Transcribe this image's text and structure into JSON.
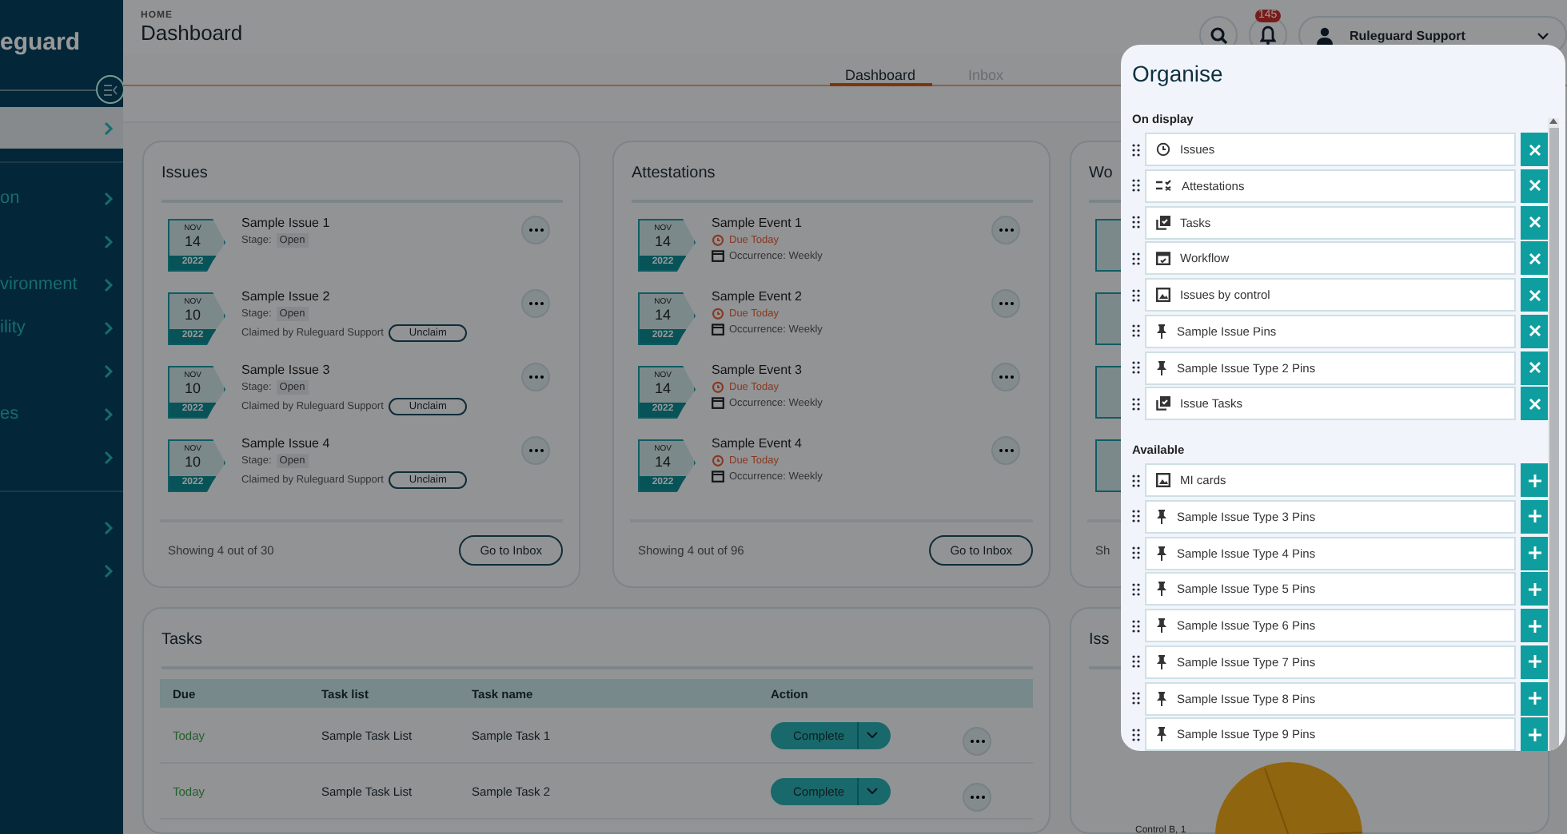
{
  "sidebar": {
    "logo": "eguard",
    "items": [
      {
        "selected": true
      },
      {
        "label": "on",
        "selected": false
      },
      {
        "selected": false
      },
      {
        "label": "vironment",
        "selected": false
      },
      {
        "label": "ility",
        "selected": false
      },
      {
        "selected": false
      },
      {
        "label": "es",
        "selected": false
      },
      {
        "selected": false
      },
      {
        "selected": false
      },
      {
        "selected": false
      }
    ]
  },
  "header": {
    "breadcrumb": "HOME",
    "title": "Dashboard",
    "notifications": "145",
    "user": "Ruleguard Support"
  },
  "tabs": [
    {
      "label": "Dashboard",
      "selected": true
    },
    {
      "label": "Inbox",
      "selected": false
    }
  ],
  "issues": {
    "title": "Issues",
    "footer": "Showing 4 out of 30",
    "button": "Go to Inbox",
    "items": [
      {
        "month": "NOV",
        "day": "14",
        "year": "2022",
        "title": "Sample Issue 1",
        "stage_label": "Stage:",
        "stage": "Open"
      },
      {
        "month": "NOV",
        "day": "10",
        "year": "2022",
        "title": "Sample Issue 2",
        "stage_label": "Stage:",
        "stage": "Open",
        "claimed": "Claimed by Ruleguard Support",
        "action": "Unclaim"
      },
      {
        "month": "NOV",
        "day": "10",
        "year": "2022",
        "title": "Sample Issue 3",
        "stage_label": "Stage:",
        "stage": "Open",
        "claimed": "Claimed by Ruleguard Support",
        "action": "Unclaim"
      },
      {
        "month": "NOV",
        "day": "10",
        "year": "2022",
        "title": "Sample Issue 4",
        "stage_label": "Stage:",
        "stage": "Open",
        "claimed": "Claimed by Ruleguard Support",
        "action": "Unclaim"
      }
    ]
  },
  "attestations": {
    "title": "Attestations",
    "footer": "Showing 4 out of 96",
    "button": "Go to Inbox",
    "items": [
      {
        "month": "NOV",
        "day": "14",
        "year": "2022",
        "title": "Sample Event 1",
        "due": "Due Today",
        "occurrence": "Occurrence: Weekly"
      },
      {
        "month": "NOV",
        "day": "14",
        "year": "2022",
        "title": "Sample Event 2",
        "due": "Due Today",
        "occurrence": "Occurrence: Weekly"
      },
      {
        "month": "NOV",
        "day": "14",
        "year": "2022",
        "title": "Sample Event 3",
        "due": "Due Today",
        "occurrence": "Occurrence: Weekly"
      },
      {
        "month": "NOV",
        "day": "14",
        "year": "2022",
        "title": "Sample Event 4",
        "due": "Due Today",
        "occurrence": "Occurrence: Weekly"
      }
    ]
  },
  "workflow": {
    "title": "Wo",
    "footer": "Sh"
  },
  "tasks": {
    "title": "Tasks",
    "columns": [
      "Due",
      "Task list",
      "Task name",
      "Action"
    ],
    "rows": [
      {
        "due": "Today",
        "list": "Sample Task List",
        "name": "Sample Task 1",
        "action": "Complete"
      },
      {
        "due": "Today",
        "list": "Sample Task List",
        "name": "Sample Task 2",
        "action": "Complete"
      }
    ]
  },
  "issues_by_control": {
    "title": "Iss",
    "label": "Control B, 1"
  },
  "organise": {
    "title": "Organise",
    "sections": [
      {
        "title": "On display",
        "kind": "remove",
        "items": [
          {
            "label": "Issues",
            "kind": "clock"
          },
          {
            "label": "Attestations",
            "kind": "checklist"
          },
          {
            "label": "Tasks",
            "kind": "tasks"
          },
          {
            "label": "Workflow",
            "kind": "calendar"
          },
          {
            "label": "Issues by control",
            "kind": "image"
          },
          {
            "label": "Sample Issue Pins",
            "kind": "pin"
          },
          {
            "label": "Sample Issue Type 2 Pins",
            "kind": "pin"
          },
          {
            "label": "Issue Tasks",
            "kind": "tasks"
          }
        ]
      },
      {
        "title": "Available",
        "kind": "add",
        "items": [
          {
            "label": "MI cards",
            "kind": "image"
          },
          {
            "label": "Sample Issue Type 3 Pins",
            "kind": "pin"
          },
          {
            "label": "Sample Issue Type 4 Pins",
            "kind": "pin"
          },
          {
            "label": "Sample Issue Type 5 Pins",
            "kind": "pin"
          },
          {
            "label": "Sample Issue Type 6 Pins",
            "kind": "pin"
          },
          {
            "label": "Sample Issue Type 7 Pins",
            "kind": "pin"
          },
          {
            "label": "Sample Issue Type 8 Pins",
            "kind": "pin"
          },
          {
            "label": "Sample Issue Type 9 Pins",
            "kind": "pin"
          }
        ]
      }
    ]
  }
}
